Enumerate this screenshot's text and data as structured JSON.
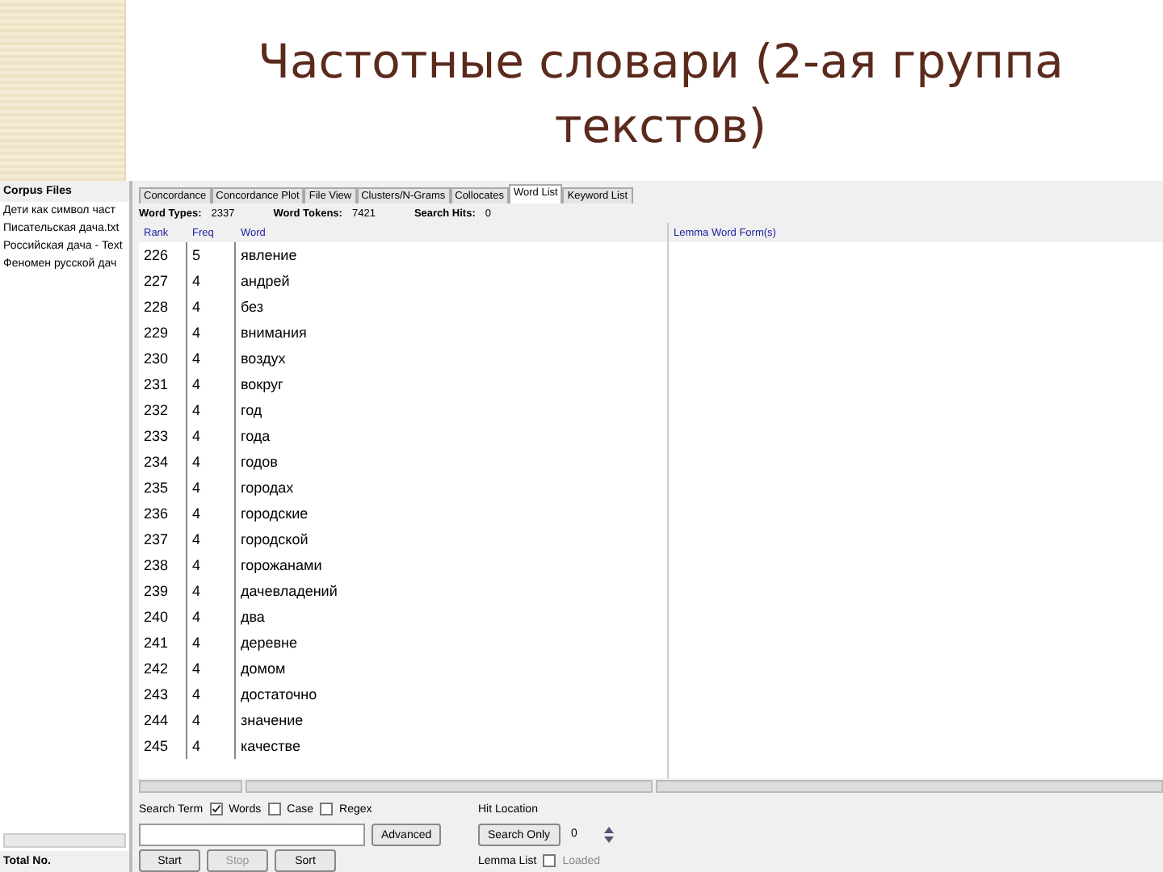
{
  "slide": {
    "title": "Частотные словари (2-ая группа текстов)"
  },
  "corpus_files": {
    "heading": "Corpus Files",
    "files": [
      "Дети как символ част",
      "Писательская дача.txt",
      "Российская дача - Text",
      "Феномен русской дач"
    ],
    "total_label": "Total No."
  },
  "tabs": [
    {
      "label": "Concordance",
      "selected": false
    },
    {
      "label": "Concordance Plot",
      "selected": false
    },
    {
      "label": "File View",
      "selected": false
    },
    {
      "label": "Clusters/N-Grams",
      "selected": false
    },
    {
      "label": "Collocates",
      "selected": false
    },
    {
      "label": "Word List",
      "selected": true
    },
    {
      "label": "Keyword List",
      "selected": false
    }
  ],
  "stats": [
    {
      "label": "Word Types:",
      "value": "2337"
    },
    {
      "label": "Word Tokens:",
      "value": "7421"
    },
    {
      "label": "Search Hits:",
      "value": "0"
    }
  ],
  "columns": {
    "rank": "Rank",
    "freq": "Freq",
    "word": "Word",
    "lemma": "Lemma Word Form(s)"
  },
  "rows": [
    {
      "rank": "226",
      "freq": "5",
      "word": "явление"
    },
    {
      "rank": "227",
      "freq": "4",
      "word": "андрей"
    },
    {
      "rank": "228",
      "freq": "4",
      "word": "без"
    },
    {
      "rank": "229",
      "freq": "4",
      "word": "внимания"
    },
    {
      "rank": "230",
      "freq": "4",
      "word": "воздух"
    },
    {
      "rank": "231",
      "freq": "4",
      "word": "вокруг"
    },
    {
      "rank": "232",
      "freq": "4",
      "word": "год"
    },
    {
      "rank": "233",
      "freq": "4",
      "word": "года"
    },
    {
      "rank": "234",
      "freq": "4",
      "word": "годов"
    },
    {
      "rank": "235",
      "freq": "4",
      "word": "городах"
    },
    {
      "rank": "236",
      "freq": "4",
      "word": "городские"
    },
    {
      "rank": "237",
      "freq": "4",
      "word": "городской"
    },
    {
      "rank": "238",
      "freq": "4",
      "word": "горожанами"
    },
    {
      "rank": "239",
      "freq": "4",
      "word": "дачевладений"
    },
    {
      "rank": "240",
      "freq": "4",
      "word": "два"
    },
    {
      "rank": "241",
      "freq": "4",
      "word": "деревне"
    },
    {
      "rank": "242",
      "freq": "4",
      "word": "домом"
    },
    {
      "rank": "243",
      "freq": "4",
      "word": "достаточно"
    },
    {
      "rank": "244",
      "freq": "4",
      "word": "значение"
    },
    {
      "rank": "245",
      "freq": "4",
      "word": "качестве"
    }
  ],
  "search": {
    "label": "Search Term",
    "options": [
      {
        "label": "Words",
        "checked": true
      },
      {
        "label": "Case",
        "checked": false
      },
      {
        "label": "Regex",
        "checked": false
      }
    ],
    "advanced_button": "Advanced",
    "hit_location": {
      "label": "Hit Location",
      "button": "Search Only",
      "value": "0"
    },
    "buttons": [
      {
        "label": "Start",
        "disabled": false
      },
      {
        "label": "Stop",
        "disabled": true
      },
      {
        "label": "Sort",
        "disabled": false
      }
    ],
    "lemma_list": {
      "label": "Lemma List",
      "checked": false,
      "status": "Loaded"
    }
  }
}
